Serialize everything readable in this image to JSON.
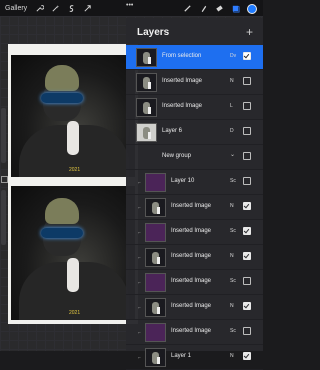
{
  "toolbar": {
    "gallery": "Gallery",
    "tools": [
      "wrench-icon",
      "magic-wand-icon",
      "selection-s-icon",
      "transform-arrow-icon"
    ],
    "more": "•••",
    "right_tools": [
      "brush-icon",
      "smudge-icon",
      "eraser-icon",
      "layers-icon"
    ],
    "color": "#1f7bff"
  },
  "canvas": {
    "stamp_top": "2021",
    "stamp_bottom": "2021"
  },
  "layers": {
    "title": "Layers",
    "add": "+",
    "items": [
      {
        "name": "From selection",
        "blend": "Dv",
        "checked": true,
        "selected": true,
        "thumb": "photo"
      },
      {
        "name": "Inserted Image",
        "blend": "N",
        "checked": false,
        "thumb": "photo"
      },
      {
        "name": "Inserted Image",
        "blend": "L",
        "checked": false,
        "thumb": "photo"
      },
      {
        "name": "Layer 6",
        "blend": "D",
        "checked": false,
        "thumb": "light"
      },
      {
        "name": "New group",
        "blend": "",
        "checked": false,
        "group": true
      },
      {
        "name": "Layer 10",
        "blend": "Sc",
        "checked": false,
        "thumb": "purple"
      },
      {
        "name": "Inserted Image",
        "blend": "N",
        "checked": true,
        "thumb": "photo"
      },
      {
        "name": "Inserted Image",
        "blend": "Sc",
        "checked": true,
        "thumb": "purple"
      },
      {
        "name": "Inserted Image",
        "blend": "N",
        "checked": true,
        "thumb": "photo"
      },
      {
        "name": "Inserted Image",
        "blend": "Sc",
        "checked": false,
        "thumb": "purple"
      },
      {
        "name": "Inserted Image",
        "blend": "N",
        "checked": true,
        "thumb": "photo"
      },
      {
        "name": "Inserted Image",
        "blend": "Sc",
        "checked": false,
        "thumb": "purple"
      },
      {
        "name": "Layer 1",
        "blend": "N",
        "checked": true,
        "thumb": "photo"
      }
    ]
  }
}
